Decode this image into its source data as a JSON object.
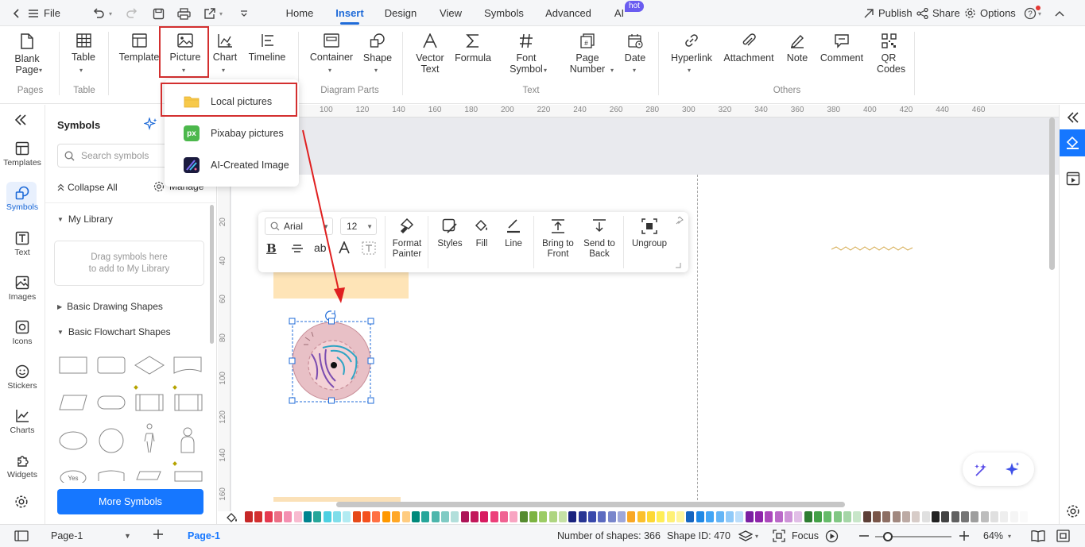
{
  "titlebar": {
    "file": "File",
    "tabs": [
      "Home",
      "Insert",
      "Design",
      "View",
      "Symbols",
      "Advanced",
      "AI"
    ],
    "active_tab": "Insert",
    "hot": "hot",
    "publish": "Publish",
    "share": "Share",
    "options": "Options"
  },
  "ribbon": {
    "blank_page": "Blank Page",
    "table": "Table",
    "template": "Template",
    "picture": "Picture",
    "chart": "Chart",
    "timeline": "Timeline",
    "container": "Container",
    "shape": "Shape",
    "vector_text": "Vector Text",
    "formula": "Formula",
    "font_symbol": "Font Symbol",
    "page_number": "Page Number",
    "date": "Date",
    "hyperlink": "Hyperlink",
    "attachment": "Attachment",
    "note": "Note",
    "comment": "Comment",
    "qr_codes": "QR Codes",
    "groups": {
      "pages": "Pages",
      "table": "Table",
      "diagram_parts": "Diagram Parts",
      "text": "Text",
      "others": "Others"
    }
  },
  "picture_menu": {
    "items": [
      "Local pictures",
      "Pixabay pictures",
      "AI-Created Image"
    ]
  },
  "rail": {
    "items": [
      "Templates",
      "Symbols",
      "Text",
      "Images",
      "Icons",
      "Stickers",
      "Charts",
      "Widgets"
    ],
    "active": "Symbols"
  },
  "symbols_panel": {
    "title": "Symbols",
    "search_placeholder": "Search symbols",
    "collapse_all": "Collapse All",
    "manage": "Manage",
    "my_library": "My Library",
    "drag_hint_1": "Drag symbols here",
    "drag_hint_2": "to add to My Library",
    "basic_drawing": "Basic Drawing Shapes",
    "basic_flowchart": "Basic Flowchart Shapes",
    "more_symbols": "More Symbols",
    "yes_label": "Yes"
  },
  "float_toolbar": {
    "font": "Arial",
    "size": "12",
    "format_painter": "Format Painter",
    "styles": "Styles",
    "fill": "Fill",
    "line": "Line",
    "bring_front": "Bring to Front",
    "send_back": "Send to Back",
    "ungroup": "Ungroup"
  },
  "ruler": {
    "h": [
      "100",
      "120",
      "140",
      "160",
      "180",
      "200",
      "220",
      "240",
      "260",
      "280",
      "300",
      "320",
      "340",
      "360",
      "380",
      "400",
      "420",
      "440",
      "460"
    ],
    "v": [
      "20",
      "40",
      "60",
      "80",
      "100",
      "120",
      "140",
      "160"
    ]
  },
  "status": {
    "page_select": "Page-1",
    "page_tab": "Page-1",
    "shapes": "Number of shapes: 366",
    "shape_id": "Shape ID: 470",
    "focus": "Focus",
    "zoom": "64%"
  },
  "palette": [
    "#c62828",
    "#d32f2f",
    "#e53950",
    "#ec6f86",
    "#f48fb1",
    "#f8bbd0",
    "#00838f",
    "#26a69a",
    "#4dd0e1",
    "#80deea",
    "#b2ebf2",
    "#e64a19",
    "#f4511e",
    "#ff7043",
    "#ff9800",
    "#ffa726",
    "#ffcc80",
    "#00897b",
    "#26a69a",
    "#4db6ac",
    "#80cbc4",
    "#b2dfdb",
    "#ad1457",
    "#c2185b",
    "#d81b60",
    "#ec407a",
    "#f06292",
    "#f8a5c2",
    "#558b2f",
    "#7cb342",
    "#9ccc65",
    "#aed581",
    "#c5e1a5",
    "#1a237e",
    "#283593",
    "#3949ab",
    "#5c6bc0",
    "#7986cb",
    "#9fa8da",
    "#f9a825",
    "#fbc02d",
    "#fdd835",
    "#ffee58",
    "#fff176",
    "#fff59d",
    "#1565c0",
    "#1e88e5",
    "#42a5f5",
    "#64b5f6",
    "#90caf9",
    "#bbdefb",
    "#7b1fa2",
    "#8e24aa",
    "#ab47bc",
    "#ba68c8",
    "#ce93d8",
    "#e1bee7",
    "#2e7d32",
    "#43a047",
    "#66bb6a",
    "#81c784",
    "#a5d6a7",
    "#c8e6c9",
    "#5d4037",
    "#795548",
    "#8d6e63",
    "#a1887f",
    "#bcaaa4",
    "#d7ccc8",
    "#e0e0e0",
    "#212121",
    "#424242",
    "#616161",
    "#757575",
    "#9e9e9e",
    "#bdbdbd",
    "#e0e0e0",
    "#eeeeee",
    "#f5f5f5",
    "#fafafa"
  ]
}
